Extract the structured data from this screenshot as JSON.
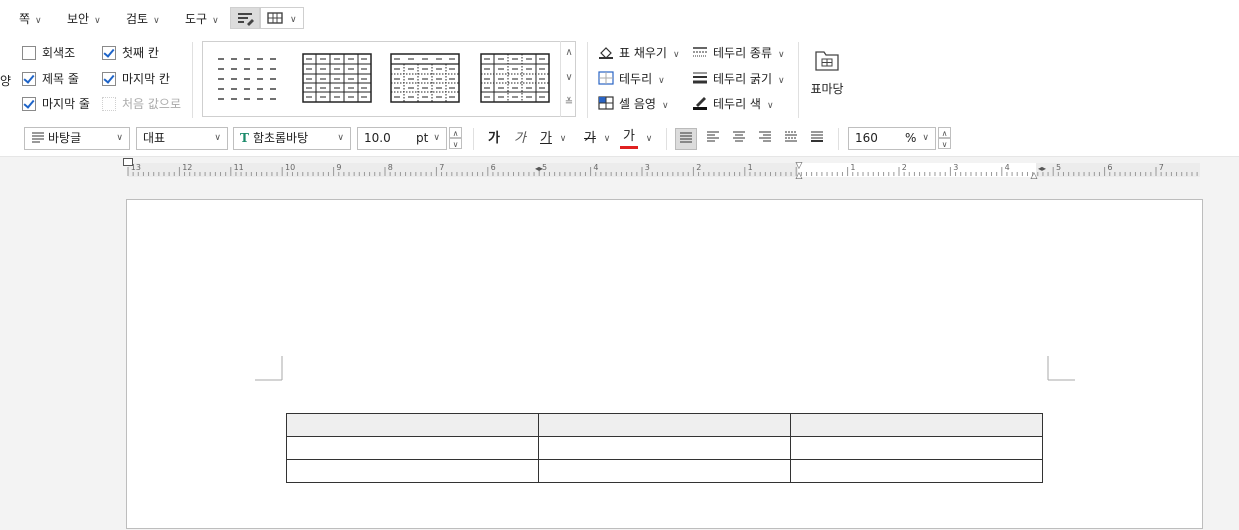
{
  "menu": [
    {
      "label": "쪽"
    },
    {
      "label": "보안"
    },
    {
      "label": "검토"
    },
    {
      "label": "도구"
    }
  ],
  "ribbon": {
    "cut_label": "양",
    "checkboxes": [
      {
        "label": "회색조",
        "checked": false,
        "disabled": false
      },
      {
        "label": "첫째 칸",
        "checked": true,
        "disabled": false
      },
      {
        "label": "제목 줄",
        "checked": true,
        "disabled": false
      },
      {
        "label": "마지막 칸",
        "checked": true,
        "disabled": false
      },
      {
        "label": "마지막 줄",
        "checked": true,
        "disabled": false
      },
      {
        "label": "처음 값으로",
        "checked": false,
        "disabled": true
      }
    ],
    "fill_label": "표 채우기",
    "border_label": "테두리",
    "cell_shade_label": "셀 음영",
    "border_type_label": "테두리 종류",
    "border_width_label": "테두리 굵기",
    "border_color_label": "테두리 색",
    "table_cut_label": "표마당",
    "colors": {
      "accent": "#1e64c8",
      "font_color": "#e02020"
    }
  },
  "format": {
    "style": "바탕글",
    "lang": "대표",
    "font": "함초롬바탕",
    "size": "10.0",
    "unit": "pt",
    "bold_label": "가",
    "italic_label": "가",
    "underline_label": "가",
    "strike_label": "가",
    "color_label": "가",
    "zoom": "160",
    "zoom_unit": "%"
  },
  "ruler": {
    "left_ticks": [
      "13",
      "12",
      "11",
      "10",
      "9",
      "8",
      "7",
      "6",
      "5",
      "4",
      "3",
      "2",
      "1"
    ],
    "right_ticks": [
      "1",
      "2",
      "3",
      "4",
      "5",
      "6",
      "7"
    ]
  },
  "table": {
    "rows": [
      [
        "",
        "",
        ""
      ],
      [
        "",
        "",
        ""
      ],
      [
        "",
        "",
        ""
      ]
    ]
  }
}
